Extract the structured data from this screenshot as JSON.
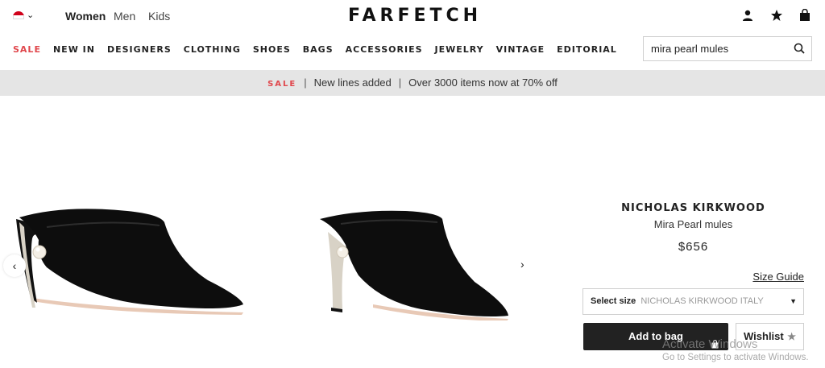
{
  "header": {
    "logo": "FARFETCH",
    "gender_tabs": [
      "Women",
      "Men",
      "Kids"
    ]
  },
  "nav": {
    "items": [
      "SALE",
      "NEW IN",
      "DESIGNERS",
      "CLOTHING",
      "SHOES",
      "BAGS",
      "ACCESSORIES",
      "JEWELRY",
      "VINTAGE",
      "EDITORIAL"
    ]
  },
  "search": {
    "value": "mira pearl mules"
  },
  "banner": {
    "sale": "SALE",
    "sep1": "|",
    "text1": "New lines added",
    "sep2": "|",
    "text2": "Over 3000 items now at 70% off"
  },
  "product": {
    "brand": "NICHOLAS KIRKWOOD",
    "name": "Mira Pearl mules",
    "price": "$656",
    "size_guide": "Size Guide",
    "select_label": "Select size",
    "select_value": "NICHOLAS KIRKWOOD ITALY",
    "add_to_bag": "Add to bag",
    "wishlist": "Wishlist"
  },
  "watermark": {
    "line1": "Activate Windows",
    "line2": "Go to Settings to activate Windows."
  },
  "colors": {
    "sale_red": "#e0474c",
    "banner_bg": "#e5e5e5",
    "button_dark": "#222222"
  },
  "icons": {
    "account": "user-icon",
    "wishlist": "star-icon",
    "bag": "bag-icon",
    "search": "search-icon"
  }
}
